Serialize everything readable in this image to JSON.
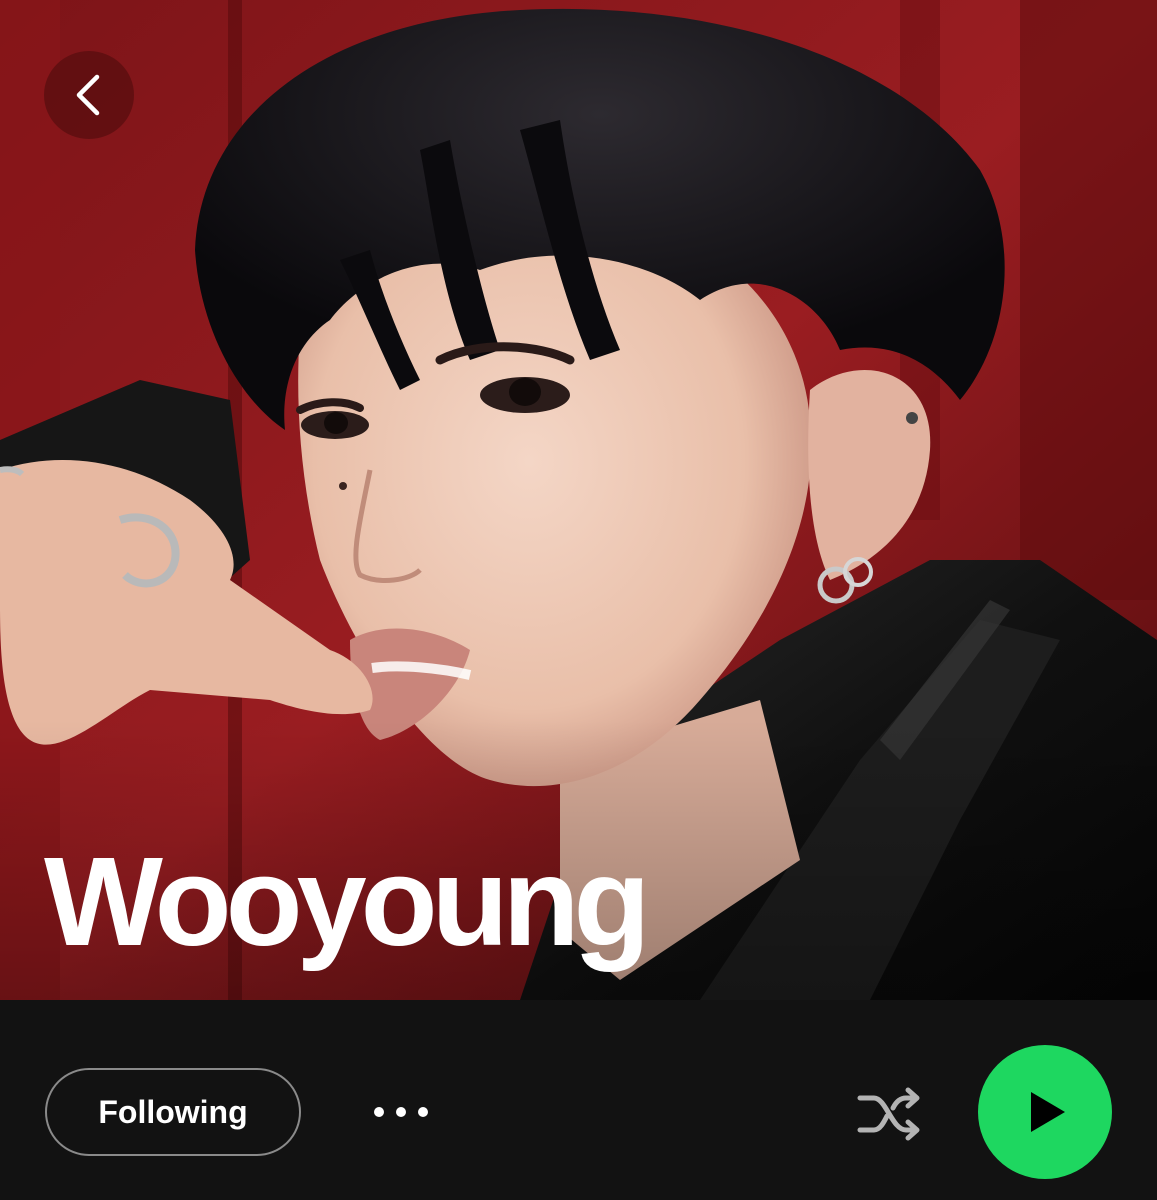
{
  "artist": {
    "name": "Wooyoung"
  },
  "header": {
    "back_icon": "chevron-left-icon"
  },
  "actions": {
    "follow_label": "Following",
    "more_icon": "more-horizontal-icon",
    "shuffle_icon": "shuffle-icon",
    "play_icon": "play-icon"
  },
  "colors": {
    "accent": "#1ed760",
    "background": "#121212",
    "hero_backdrop": "#6e0f12",
    "text": "#ffffff",
    "outline": "#8a8a8a"
  }
}
